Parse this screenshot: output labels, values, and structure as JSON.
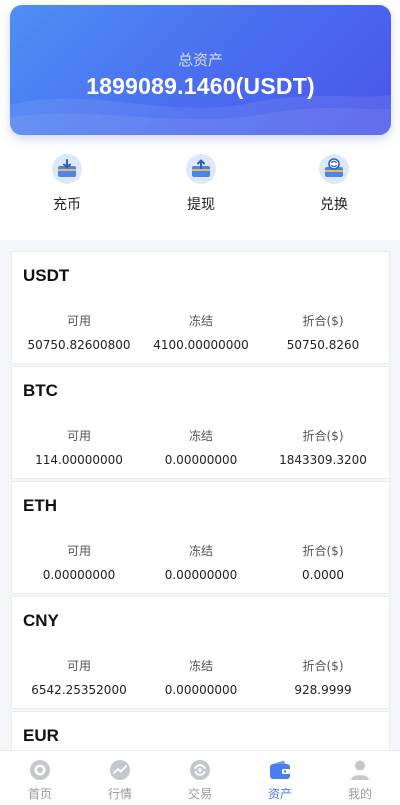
{
  "header": {
    "label": "总资产",
    "total": "1899089.1460(USDT)"
  },
  "actions": [
    {
      "label": "充币",
      "icon": "deposit-icon"
    },
    {
      "label": "提现",
      "icon": "withdraw-icon"
    },
    {
      "label": "兑换",
      "icon": "exchange-icon"
    }
  ],
  "assets": [
    {
      "symbol": "USDT",
      "available_label": "可用",
      "frozen_label": "冻结",
      "converted_label": "折合($)",
      "available": "50750.82600800",
      "frozen": "4100.00000000",
      "converted": "50750.8260"
    },
    {
      "symbol": "BTC",
      "available_label": "可用",
      "frozen_label": "冻结",
      "converted_label": "折合($)",
      "available": "114.00000000",
      "frozen": "0.00000000",
      "converted": "1843309.3200"
    },
    {
      "symbol": "ETH",
      "available_label": "可用",
      "frozen_label": "冻结",
      "converted_label": "折合($)",
      "available": "0.00000000",
      "frozen": "0.00000000",
      "converted": "0.0000"
    },
    {
      "symbol": "CNY",
      "available_label": "可用",
      "frozen_label": "冻结",
      "converted_label": "折合($)",
      "available": "6542.25352000",
      "frozen": "0.00000000",
      "converted": "928.9999"
    },
    {
      "symbol": "EUR"
    }
  ],
  "tabbar": [
    {
      "label": "首页",
      "icon": "home-icon",
      "active": false
    },
    {
      "label": "行情",
      "icon": "market-icon",
      "active": false
    },
    {
      "label": "交易",
      "icon": "trade-icon",
      "active": false
    },
    {
      "label": "资产",
      "icon": "wallet-icon",
      "active": true
    },
    {
      "label": "我的",
      "icon": "profile-icon",
      "active": false
    }
  ],
  "colors": {
    "accent": "#4a7ef0",
    "hero_start": "#4e8ff3",
    "hero_end": "#4a55ea",
    "icon_bg": "#dde8fb"
  }
}
